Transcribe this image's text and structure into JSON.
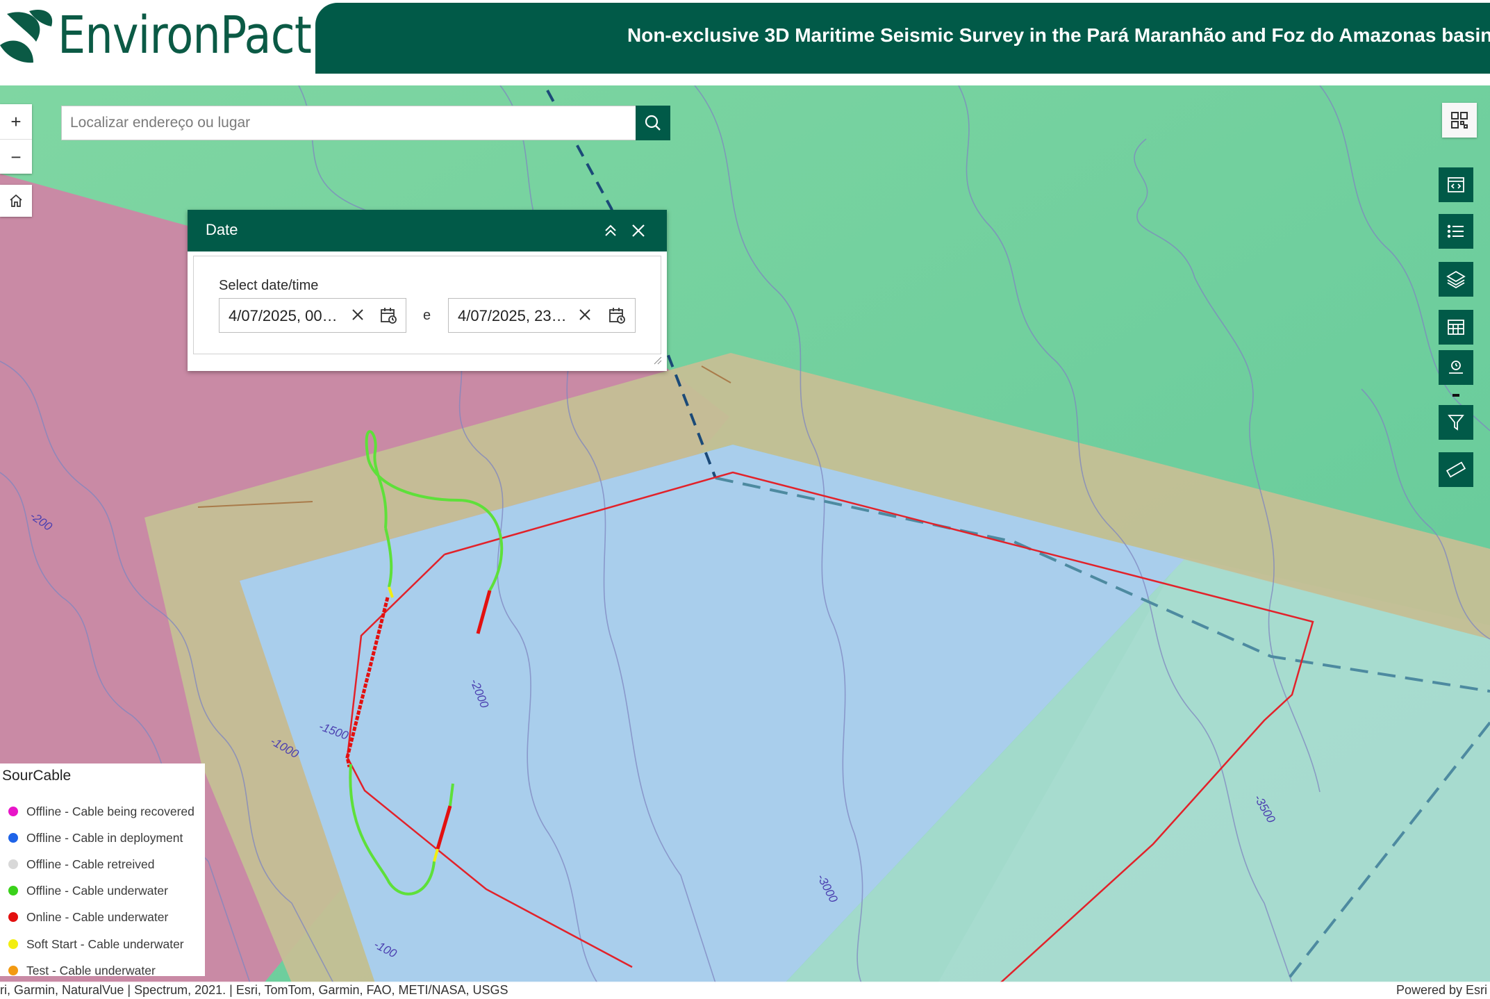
{
  "header": {
    "logo_text": "EnvironPact",
    "title": "Non-exclusive 3D Maritime Seismic Survey in the Pará Maranhão and Foz do Amazonas basin"
  },
  "search": {
    "placeholder": "Localizar endereço ou lugar"
  },
  "zoom": {
    "in_label": "+",
    "out_label": "−"
  },
  "date_panel": {
    "title": "Date",
    "label": "Select date/time",
    "start_value": "4/07/2025, 00…",
    "separator": "e",
    "end_value": "4/07/2025, 23…"
  },
  "map_labels": {
    "contour_200": "-200",
    "contour_1000": "-1000",
    "contour_1500": "-1500",
    "contour_2000": "-2000",
    "contour_3000": "-3000",
    "contour_3500": "-3500",
    "contour_100": "-100"
  },
  "legend": {
    "title": "SourCable",
    "items": [
      {
        "label": "Offline - Cable being recovered",
        "color": "#e815c8"
      },
      {
        "label": "Offline - Cable in deployment",
        "color": "#1e63e8"
      },
      {
        "label": "Offline - Cable retreived",
        "color": "#d8d8d8"
      },
      {
        "label": "Offline - Cable underwater",
        "color": "#3ad11a"
      },
      {
        "label": "Online - Cable underwater",
        "color": "#e3100f"
      },
      {
        "label": "Soft Start - Cable underwater",
        "color": "#f2ee10"
      },
      {
        "label": "Test - Cable underwater",
        "color": "#f29a12"
      }
    ]
  },
  "attribution": {
    "left": "ri, Garmin, NaturalVue | Spectrum, 2021. | Esri, TomTom, Garmin, FAO, METI/NASA, USGS",
    "right": "Powered by Esri"
  },
  "toolbar_icons": [
    "qr-code-icon",
    "embed-icon",
    "list-icon",
    "layers-icon",
    "table-icon",
    "location-icon",
    "filter-icon",
    "measure-icon"
  ]
}
